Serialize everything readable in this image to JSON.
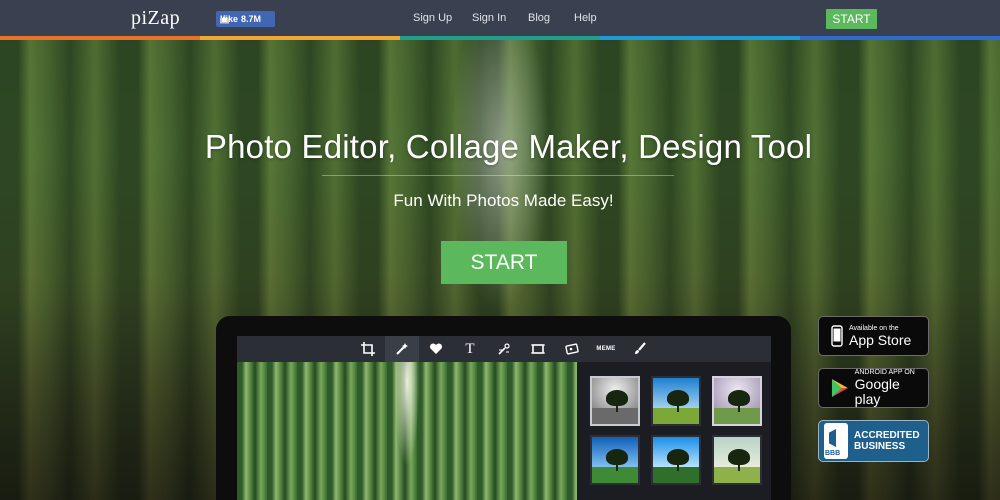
{
  "header": {
    "logo": "piZap",
    "like_label": "Like",
    "like_count": "8.7M",
    "nav": [
      "Sign Up",
      "Sign In",
      "Blog",
      "Help"
    ],
    "start_label": "START",
    "colorbar": [
      "#e8742a",
      "#f2a633",
      "#1f9e8c",
      "#1f9ad6",
      "#2e6bd0"
    ]
  },
  "hero": {
    "title": "Photo Editor, Collage Maker, Design Tool",
    "subtitle": "Fun With Photos Made Easy!",
    "start_label": "START"
  },
  "editor": {
    "tools": [
      "crop-icon",
      "magic-wand-icon",
      "heart-icon",
      "text-icon",
      "effects-icon",
      "frame-icon",
      "sticker-icon",
      "meme-icon",
      "brush-icon"
    ],
    "tool_text": "T",
    "meme_label": "MEME"
  },
  "badges": {
    "appstore": {
      "top": "Available on the",
      "main": "App Store"
    },
    "googleplay": {
      "top": "ANDROID APP ON",
      "main": "Google play"
    },
    "bbb": {
      "line1": "ACCREDITED",
      "line2": "BUSINESS",
      "seal": "BBB"
    }
  }
}
